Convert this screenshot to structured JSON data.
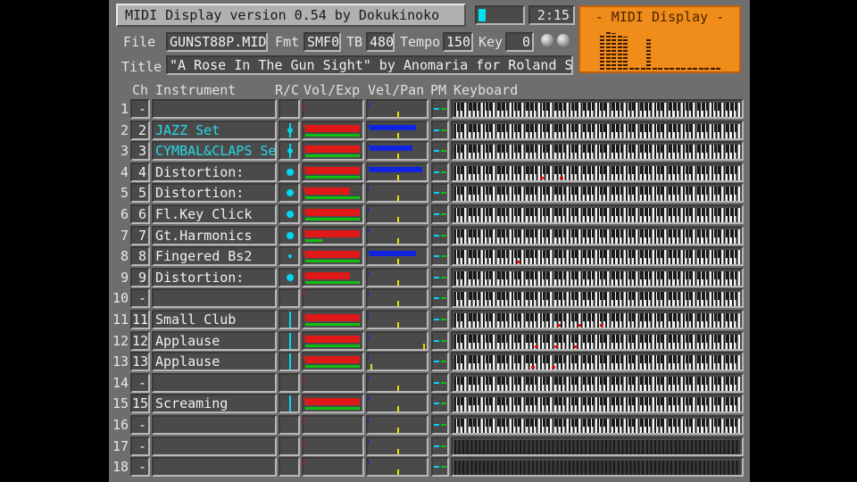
{
  "app": {
    "title": "MIDI Display  version 0.54  by Dokukinoko",
    "time": "2:15",
    "progress": 0.15,
    "logo_title": "- MIDI Display -",
    "logo_levels": [
      0.85,
      0.95,
      0.9,
      0.85,
      0.8,
      0.05,
      0.05,
      0.05,
      0.75,
      0.05,
      0.05,
      0.05,
      0.05,
      0.05,
      0.05,
      0.05,
      0.05,
      0.05,
      0.05,
      0.05,
      0.05
    ]
  },
  "info": {
    "file_label": "File",
    "file": "GUNST88P.MID",
    "fmt_label": "Fmt",
    "fmt": "SMF0",
    "tb_label": "TB",
    "tb": "480",
    "tempo_label": "Tempo",
    "tempo": "150",
    "key_label": "Key",
    "key": "0",
    "title_label": "Title",
    "title": "\"A Rose In The Gun Sight\" by Anomaria for Roland S"
  },
  "headers": {
    "ch": "Ch",
    "instrument": "Instrument",
    "rc": "R/C",
    "volexp": "Vol/Exp",
    "velpan": "Vel/Pan",
    "pm": "PM",
    "keyboard": "Keyboard"
  },
  "colors": {
    "accent": "#00d8f0",
    "vol": "#e01818",
    "exp": "#10c010",
    "vel": "#1024e0",
    "pan": "#e8e000",
    "logo": "#f08c1a"
  },
  "channels": [
    {
      "n": "1",
      "ch": "--",
      "inst": "",
      "cyan": false,
      "rc": "none",
      "vol": 0,
      "exp": 0,
      "vel": 0,
      "pan": 0.5,
      "notes": [],
      "dark": false
    },
    {
      "n": "2",
      "ch": "2",
      "inst": "JAZZ Set",
      "cyan": true,
      "rc": "bar",
      "vol": 0.95,
      "exp": 0.95,
      "vel": 0.82,
      "pan": 0.5,
      "notes": [],
      "dark": false
    },
    {
      "n": "3",
      "ch": "3",
      "inst": "CYMBAL&CLAPS Se",
      "cyan": true,
      "rc": "bar",
      "vol": 0.95,
      "exp": 0.95,
      "vel": 0.75,
      "pan": 0.5,
      "notes": [],
      "dark": false
    },
    {
      "n": "4",
      "ch": "4",
      "inst": "Distortion:",
      "cyan": false,
      "rc": "dot",
      "vol": 0.95,
      "exp": 0.95,
      "vel": 0.92,
      "pan": 0.5,
      "notes": [
        0.3,
        0.37
      ],
      "dark": false
    },
    {
      "n": "5",
      "ch": "5",
      "inst": "Distortion:",
      "cyan": false,
      "rc": "dot",
      "vol": 0.78,
      "exp": 0.95,
      "vel": 0,
      "pan": 0.5,
      "notes": [],
      "dark": false
    },
    {
      "n": "6",
      "ch": "6",
      "inst": "Fl.Key Click",
      "cyan": false,
      "rc": "dot",
      "vol": 0.95,
      "exp": 0.95,
      "vel": 0,
      "pan": 0.5,
      "notes": [],
      "dark": false
    },
    {
      "n": "7",
      "ch": "7",
      "inst": "Gt.Harmonics",
      "cyan": false,
      "rc": "dot",
      "vol": 0.95,
      "exp": 0.3,
      "vel": 0,
      "pan": 0.5,
      "notes": [],
      "dark": false
    },
    {
      "n": "8",
      "ch": "8",
      "inst": "Fingered Bs2",
      "cyan": false,
      "rc": "small",
      "vol": 0.95,
      "exp": 0.95,
      "vel": 0.82,
      "pan": 0.5,
      "notes": [
        0.22
      ],
      "dark": false
    },
    {
      "n": "9",
      "ch": "9",
      "inst": "Distortion:",
      "cyan": false,
      "rc": "dot",
      "vol": 0.78,
      "exp": 0.95,
      "vel": 0,
      "pan": 0.5,
      "notes": [],
      "dark": false
    },
    {
      "n": "10",
      "ch": "--",
      "inst": "",
      "cyan": false,
      "rc": "none",
      "vol": 0,
      "exp": 0,
      "vel": 0,
      "pan": 0.5,
      "notes": [],
      "dark": false
    },
    {
      "n": "11",
      "ch": "11",
      "inst": "Small Club",
      "cyan": false,
      "rc": "line",
      "vol": 0.95,
      "exp": 0.95,
      "vel": 0,
      "pan": 0.5,
      "notes": [
        0.36,
        0.43,
        0.51
      ],
      "dark": false
    },
    {
      "n": "12",
      "ch": "12",
      "inst": "Applause",
      "cyan": false,
      "rc": "line",
      "vol": 0.95,
      "exp": 0.95,
      "vel": 0,
      "pan": 0.97,
      "notes": [
        0.28,
        0.35,
        0.42
      ],
      "dark": false
    },
    {
      "n": "13",
      "ch": "13",
      "inst": "Applause",
      "cyan": false,
      "rc": "line",
      "vol": 0.95,
      "exp": 0.95,
      "vel": 0,
      "pan": 0.02,
      "notes": [
        0.27,
        0.34
      ],
      "dark": false
    },
    {
      "n": "14",
      "ch": "--",
      "inst": "",
      "cyan": false,
      "rc": "none",
      "vol": 0,
      "exp": 0,
      "vel": 0,
      "pan": 0.5,
      "notes": [],
      "dark": false
    },
    {
      "n": "15",
      "ch": "15",
      "inst": "Screaming",
      "cyan": false,
      "rc": "line",
      "vol": 0.95,
      "exp": 0.95,
      "vel": 0,
      "pan": 0.5,
      "notes": [],
      "dark": false
    },
    {
      "n": "16",
      "ch": "--",
      "inst": "",
      "cyan": false,
      "rc": "none",
      "vol": 0,
      "exp": 0,
      "vel": 0,
      "pan": 0.5,
      "notes": [],
      "dark": false
    },
    {
      "n": "17",
      "ch": "--",
      "inst": "",
      "cyan": false,
      "rc": "none",
      "vol": 0,
      "exp": 0,
      "vel": 0,
      "pan": 0.5,
      "notes": [],
      "dark": true
    },
    {
      "n": "18",
      "ch": "--",
      "inst": "",
      "cyan": false,
      "rc": "none",
      "vol": 0,
      "exp": 0,
      "vel": 0,
      "pan": 0.5,
      "notes": [],
      "dark": true
    }
  ]
}
